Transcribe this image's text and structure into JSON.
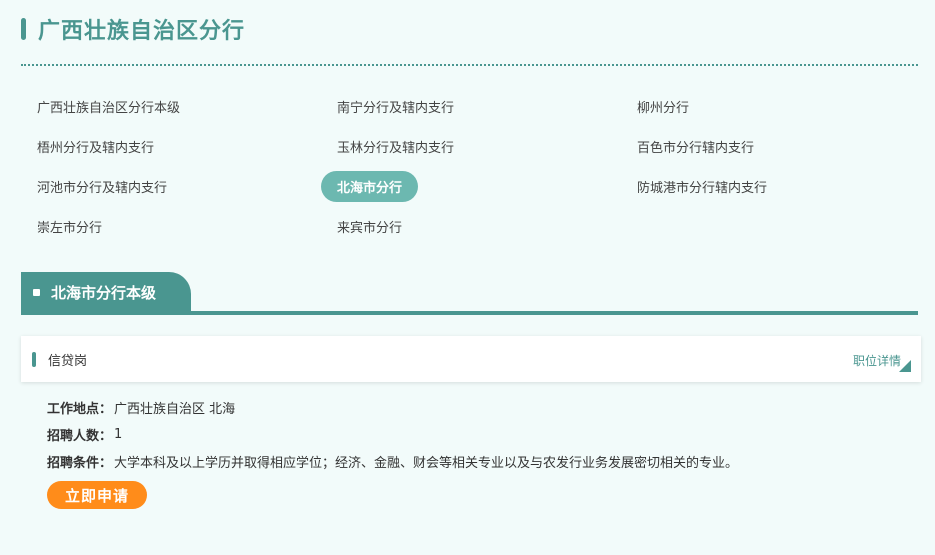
{
  "page": {
    "title": "广西壮族自治区分行"
  },
  "branches": [
    {
      "label": "广西壮族自治区分行本级",
      "active": false
    },
    {
      "label": "南宁分行及辖内支行",
      "active": false
    },
    {
      "label": "柳州分行",
      "active": false
    },
    {
      "label": "梧州分行及辖内支行",
      "active": false
    },
    {
      "label": "玉林分行及辖内支行",
      "active": false
    },
    {
      "label": "百色市分行辖内支行",
      "active": false
    },
    {
      "label": "河池市分行及辖内支行",
      "active": false
    },
    {
      "label": "北海市分行",
      "active": true
    },
    {
      "label": "防城港市分行辖内支行",
      "active": false
    },
    {
      "label": "崇左市分行",
      "active": false
    },
    {
      "label": "来宾市分行",
      "active": false
    }
  ],
  "section": {
    "title": "北海市分行本级"
  },
  "job": {
    "title": "信贷岗",
    "detail_link": "职位详情",
    "location_label": "工作地点：",
    "location_value": "广西壮族自治区 北海",
    "count_label": "招聘人数：",
    "count_value": "1",
    "requirements_label": "招聘条件：",
    "requirements_value": "大学本科及以上学历并取得相应学位；经济、金融、财会等相关专业以及与农发行业务发展密切相关的专业。",
    "apply_label": "立即申请"
  },
  "colors": {
    "accent": "#4a9690",
    "active_pill": "#6cb8b0",
    "apply": "#ff8c1a",
    "background": "#f2fbfa"
  }
}
